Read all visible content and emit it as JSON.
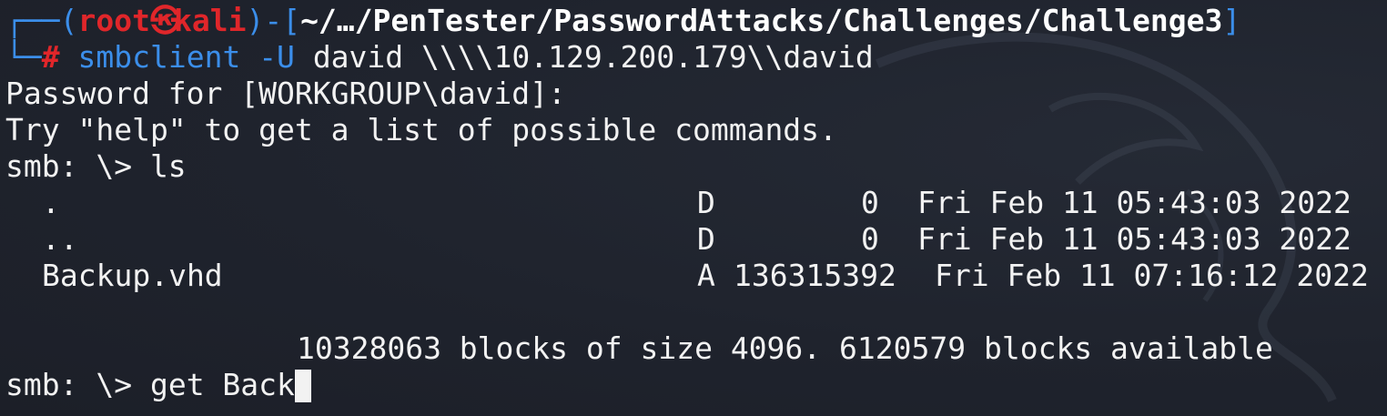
{
  "prompt": {
    "box_top": "┌──(",
    "user": "root",
    "skull": "㉿",
    "host": "kali",
    "mid": ")-[",
    "path": "~/…/PenTester/PasswordAttacks/Challenges/Challenge3",
    "close": "]",
    "box_bottom": "└─",
    "hash": "#",
    "command_name": "smbclient",
    "command_flag": "-U",
    "command_args": "david \\\\\\\\10.129.200.179\\\\david"
  },
  "output": {
    "password_line": "Password for [WORKGROUP\\david]:",
    "help_line": "Try \"help\" to get a list of possible commands.",
    "ls_line": "smb: \\> ls"
  },
  "listing": [
    {
      "name": ".",
      "attr": "D",
      "size": "0",
      "date": "Fri Feb 11 05:43:03 2022"
    },
    {
      "name": "..",
      "attr": "D",
      "size": "0",
      "date": "Fri Feb 11 05:43:03 2022"
    },
    {
      "name": "Backup.vhd",
      "attr": "A",
      "size": "136315392",
      "date": "Fri Feb 11 07:16:12 2022"
    }
  ],
  "summary": "10328063 blocks of size 4096. 6120579 blocks available",
  "current_input": {
    "prompt": "smb: \\> ",
    "typed": "get Back"
  },
  "colors": {
    "background": "#1f232d",
    "prompt_blue": "#3b8eea",
    "prompt_red": "#e0262a",
    "text": "#f2f2f2"
  }
}
